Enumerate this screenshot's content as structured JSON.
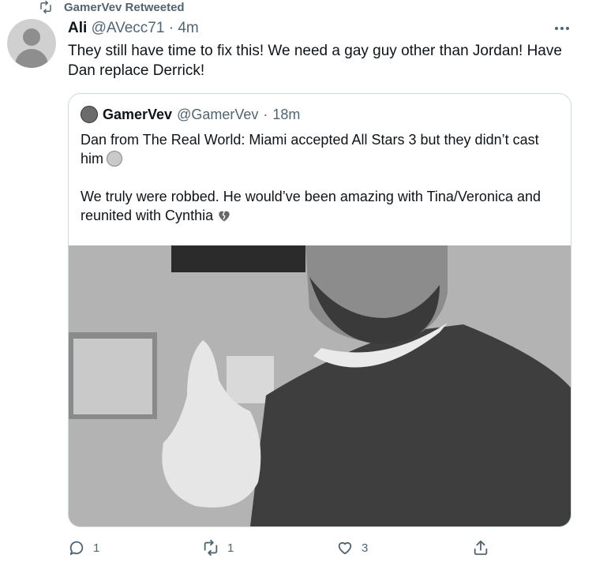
{
  "retweet": {
    "label": "GamerVev Retweeted"
  },
  "tweet": {
    "name": "Ali",
    "handle": "@AVecc71",
    "separator": "·",
    "time": "4m",
    "text": "They still have time to fix this! We need a gay guy other than Jordan! Have Dan replace Derrick!"
  },
  "quote": {
    "name": "GamerVev",
    "handle": "@GamerVev",
    "separator": "·",
    "time": "18m",
    "text_line1": "Dan from The Real World: Miami accepted All Stars 3 but they didn’t cast him",
    "text_line2": "We truly were robbed. He would’ve been amazing with Tina/Veronica and reunited with Cynthia"
  },
  "actions": {
    "reply_count": "1",
    "retweet_count": "1",
    "like_count": "3"
  },
  "icons": {
    "retweet": "retweet-icon",
    "more": "more-icon",
    "reply": "reply-icon",
    "like": "heart-icon",
    "share": "share-icon",
    "emoji1": "disappointed-face-icon",
    "emoji2": "broken-heart-icon"
  },
  "colors": {
    "text": "#0f1419",
    "secondary": "#536471",
    "border": "#cfd9de"
  }
}
